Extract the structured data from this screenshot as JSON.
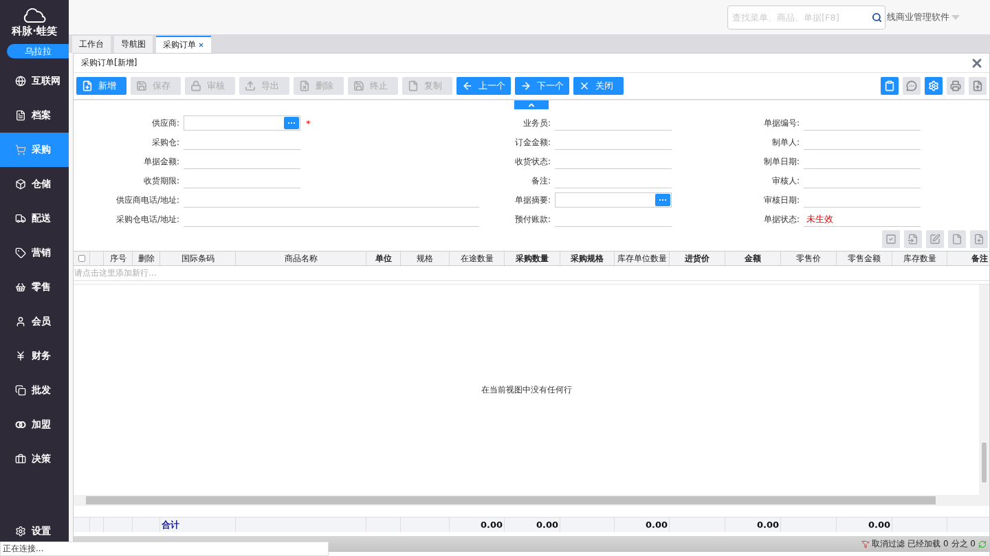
{
  "sidebar": {
    "brand": "科脉·蛙笑",
    "user": "乌拉拉",
    "items": [
      {
        "label": "互联网",
        "selected": false
      },
      {
        "label": "档案",
        "selected": false
      },
      {
        "label": "采购",
        "selected": true
      },
      {
        "label": "仓储",
        "selected": false
      },
      {
        "label": "配送",
        "selected": false
      },
      {
        "label": "营销",
        "selected": false
      },
      {
        "label": "零售",
        "selected": false
      },
      {
        "label": "会员",
        "selected": false
      },
      {
        "label": "财务",
        "selected": false
      },
      {
        "label": "批发",
        "selected": false
      },
      {
        "label": "加盟",
        "selected": false
      },
      {
        "label": "决策",
        "selected": false
      }
    ],
    "settings": "设置"
  },
  "header": {
    "search": {
      "placeholder": "查找菜单、商品、单据[F8]"
    },
    "product": "线商业管理软件"
  },
  "tabs": [
    {
      "label": "工作台",
      "selected": false,
      "closable": false
    },
    {
      "label": "导航图",
      "selected": false,
      "closable": false
    },
    {
      "label": "采购订单",
      "selected": true,
      "closable": true
    }
  ],
  "panel": {
    "title": "采购订单[新增]",
    "toolbar": [
      {
        "label": "新增",
        "enabled": true
      },
      {
        "label": "保存",
        "enabled": false
      },
      {
        "label": "审核",
        "enabled": false
      },
      {
        "label": "导出",
        "enabled": false
      },
      {
        "label": "删除",
        "enabled": false
      },
      {
        "label": "终止",
        "enabled": false
      },
      {
        "label": "复制",
        "enabled": false
      },
      {
        "label": "上一个",
        "enabled": true
      },
      {
        "label": "下一个",
        "enabled": true
      },
      {
        "label": "关闭",
        "enabled": true
      }
    ],
    "tools": [
      {
        "active": true
      },
      {
        "active": false
      },
      {
        "active": true
      },
      {
        "active": false
      },
      {
        "active": false
      }
    ],
    "form": [
      [
        {
          "label": "供应商:",
          "lookup": true,
          "wide": false,
          "required_mark": "*"
        },
        {
          "label": "采购仓:",
          "lookup": false,
          "wide": false
        },
        {
          "label": "单据金额:",
          "lookup": false,
          "wide": false
        },
        {
          "label": "收货期限:",
          "lookup": false,
          "wide": false
        },
        {
          "label": "供应商电话/地址:",
          "lookup": false,
          "wide": true
        },
        {
          "label": "采购仓电话/地址:",
          "lookup": false,
          "wide": true
        }
      ],
      [
        {
          "label": "业务员:",
          "lookup": false,
          "wide": false
        },
        {
          "label": "订金金额:",
          "lookup": false,
          "wide": false
        },
        {
          "label": "收货状态:",
          "lookup": false,
          "wide": false
        },
        {
          "label": "备注:",
          "lookup": false,
          "wide": false
        },
        {
          "label": "单据摘要:",
          "lookup": true,
          "wide": false
        },
        {
          "label": "预付账款:",
          "lookup": false,
          "wide": false
        }
      ],
      [
        {
          "label": "单据编号:",
          "lookup": false,
          "wide": false
        },
        {
          "label": "制单人:",
          "lookup": false,
          "wide": false
        },
        {
          "label": "制单日期:",
          "lookup": false,
          "wide": false
        },
        {
          "label": "审核人:",
          "lookup": false,
          "wide": false
        },
        {
          "label": "审核日期:",
          "lookup": false,
          "wide": false
        },
        {
          "label": "单据状态:",
          "lookup": false,
          "wide": false,
          "value": "未生效",
          "alert": true
        }
      ]
    ],
    "grid": {
      "columns": [
        {
          "kind": "checkbox",
          "checked": false
        },
        {
          "kind": "blank"
        },
        {
          "kind": "text",
          "label": "序号",
          "bold": false
        },
        {
          "kind": "text",
          "label": "删除",
          "bold": false
        },
        {
          "kind": "text",
          "label": "国际条码",
          "bold": false,
          "total": "合计"
        },
        {
          "kind": "text",
          "label": "商品名称",
          "bold": false
        },
        {
          "kind": "text",
          "label": "单位",
          "bold": true
        },
        {
          "kind": "text",
          "label": "规格",
          "bold": false
        },
        {
          "kind": "text",
          "label": "在途数量",
          "bold": false,
          "total": "0.00"
        },
        {
          "kind": "text",
          "label": "采购数量",
          "bold": true,
          "total": "0.00"
        },
        {
          "kind": "text",
          "label": "采购规格",
          "bold": true
        },
        {
          "kind": "text",
          "label": "库存单位数量",
          "bold": false,
          "total": "0.00"
        },
        {
          "kind": "text",
          "label": "进货价",
          "bold": true
        },
        {
          "kind": "text",
          "label": "金额",
          "bold": true,
          "total": "0.00"
        },
        {
          "kind": "text",
          "label": "零售价",
          "bold": false
        },
        {
          "kind": "text",
          "label": "零售金额",
          "bold": false,
          "total": "0.00"
        },
        {
          "kind": "text",
          "label": "库存数量",
          "bold": false
        },
        {
          "kind": "text",
          "label": "备注",
          "bold": true
        }
      ],
      "add_row": "请点击这里添加新行...",
      "empty": "在当前视图中没有任何行"
    },
    "status": {
      "filter": "取消过滤",
      "loaded": "已经加载 0 分之 0"
    }
  },
  "connection": "正在连接..."
}
